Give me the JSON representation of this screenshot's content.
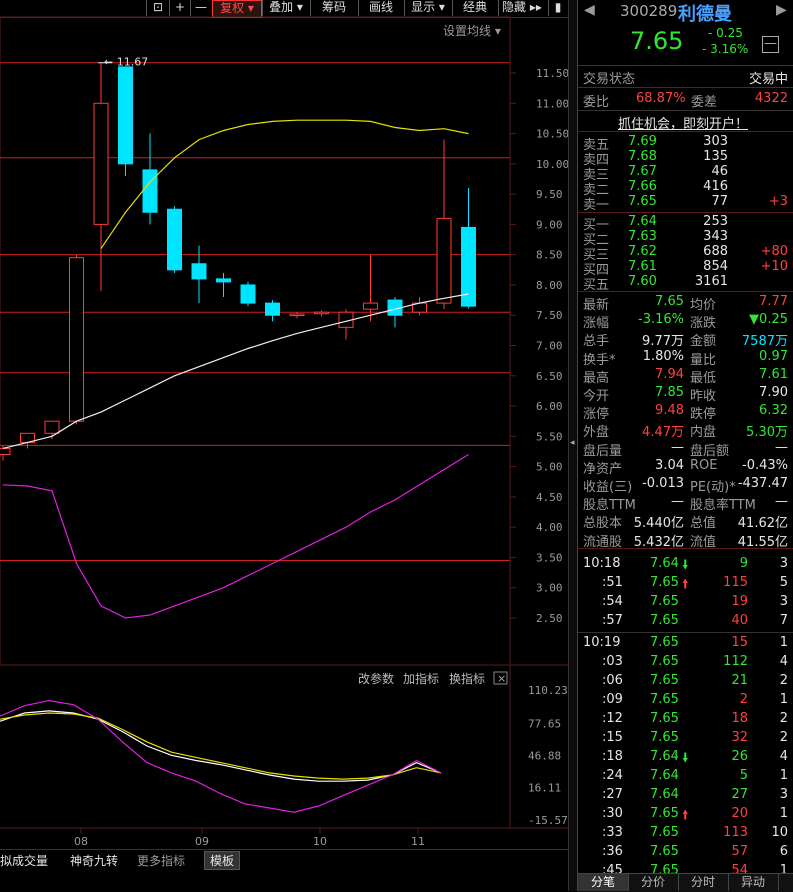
{
  "toolbar": {
    "buttons": [
      "+",
      "—",
      "复权",
      "叠加",
      "筹码",
      "画线",
      "显示",
      "经典",
      "隐藏"
    ],
    "active": "复权",
    "setting": "设置均线"
  },
  "chart_data": [
    {
      "type": "candlestick",
      "title": "",
      "ylim": [
        2.0,
        11.8
      ],
      "y_ticks": [
        "11.50",
        "11.00",
        "10.50",
        "10.00",
        "9.50",
        "9.00",
        "8.50",
        "8.00",
        "7.50",
        "7.00",
        "6.50",
        "6.00",
        "5.50",
        "5.00",
        "4.50",
        "4.00",
        "3.50",
        "3.00",
        "2.50"
      ],
      "x_ticks": [
        "08",
        "09",
        "10",
        "11"
      ],
      "max_label": "11.67",
      "candles": [
        {
          "o": 5.2,
          "h": 5.35,
          "l": 5.1,
          "c": 5.3
        },
        {
          "o": 5.4,
          "h": 5.55,
          "l": 5.3,
          "c": 5.55
        },
        {
          "o": 5.55,
          "h": 5.75,
          "l": 5.45,
          "c": 5.75
        },
        {
          "o": 5.75,
          "h": 8.5,
          "l": 5.7,
          "c": 8.45
        },
        {
          "o": 9.0,
          "h": 11.67,
          "l": 7.9,
          "c": 11.0
        },
        {
          "o": 11.6,
          "h": 11.6,
          "l": 9.8,
          "c": 10.0
        },
        {
          "o": 9.9,
          "h": 10.5,
          "l": 9.0,
          "c": 9.2
        },
        {
          "o": 9.25,
          "h": 9.3,
          "l": 8.2,
          "c": 8.25
        },
        {
          "o": 8.35,
          "h": 8.65,
          "l": 7.7,
          "c": 8.1
        },
        {
          "o": 8.1,
          "h": 8.2,
          "l": 7.8,
          "c": 8.05
        },
        {
          "o": 8.0,
          "h": 8.05,
          "l": 7.65,
          "c": 7.7
        },
        {
          "o": 7.7,
          "h": 7.75,
          "l": 7.4,
          "c": 7.5
        },
        {
          "o": 7.5,
          "h": 7.55,
          "l": 7.45,
          "c": 7.52
        },
        {
          "o": 7.53,
          "h": 7.58,
          "l": 7.48,
          "c": 7.55
        },
        {
          "o": 7.3,
          "h": 7.6,
          "l": 7.1,
          "c": 7.55
        },
        {
          "o": 7.6,
          "h": 8.5,
          "l": 7.4,
          "c": 7.7
        },
        {
          "o": 7.75,
          "h": 7.8,
          "l": 7.3,
          "c": 7.5
        },
        {
          "o": 7.55,
          "h": 7.8,
          "l": 7.5,
          "c": 7.7
        },
        {
          "o": 7.7,
          "h": 10.4,
          "l": 7.6,
          "c": 9.1
        },
        {
          "o": 8.95,
          "h": 9.6,
          "l": 7.61,
          "c": 7.65
        }
      ],
      "ma_yellow": [
        null,
        null,
        null,
        null,
        8.6,
        9.2,
        9.7,
        10.1,
        10.4,
        10.55,
        10.65,
        10.7,
        10.72,
        10.72,
        10.72,
        10.7,
        10.6,
        10.55,
        10.58,
        10.5
      ],
      "ma_white": [
        5.3,
        5.4,
        5.5,
        5.75,
        5.9,
        6.1,
        6.3,
        6.5,
        6.65,
        6.8,
        6.95,
        7.08,
        7.2,
        7.3,
        7.4,
        7.5,
        7.6,
        7.7,
        7.78,
        7.85
      ],
      "ma_magenta": [
        4.7,
        4.68,
        4.6,
        3.4,
        2.7,
        2.5,
        2.55,
        2.7,
        2.85,
        3.0,
        3.2,
        3.4,
        3.6,
        3.8,
        4.0,
        4.25,
        4.45,
        4.7,
        4.95,
        5.2
      ],
      "hlines": [
        11.67,
        10.1,
        8.5,
        7.55,
        6.55,
        5.35,
        3.45
      ]
    },
    {
      "type": "line",
      "title": "",
      "ylim": [
        -15.57,
        110.23
      ],
      "y_ticks": [
        "110.23",
        "77.65",
        "46.88",
        "16.11",
        "-15.57"
      ],
      "series": [
        {
          "values": [
            80,
            88,
            90,
            88,
            82,
            70,
            56,
            47,
            42,
            38,
            33,
            28,
            24,
            22,
            22,
            23,
            28,
            40,
            30
          ]
        },
        {
          "values": [
            82,
            86,
            88,
            87,
            83,
            72,
            60,
            50,
            45,
            40,
            35,
            30,
            27,
            25,
            24,
            25,
            28,
            35,
            30
          ]
        },
        {
          "values": [
            85,
            95,
            100,
            96,
            82,
            60,
            40,
            30,
            22,
            10,
            0,
            -4,
            -8,
            -2,
            8,
            18,
            28,
            42,
            30
          ]
        }
      ],
      "controls": [
        "改参数",
        "加指标",
        "换指标"
      ]
    }
  ],
  "bottom": {
    "items": [
      "拟成交量",
      "神奇九转",
      "更多指标",
      "模板"
    ]
  },
  "quote": {
    "code": "300289",
    "name": "利德曼",
    "price": "7.65",
    "change": "- 0.25",
    "pct": "- 3.16%",
    "status_label": "交易状态",
    "status_value": "交易中",
    "wb_label": "委比",
    "wb_value": "68.87%",
    "wc_label": "委差",
    "wc_value": "4322",
    "ad": "抓住机会，即刻开户！",
    "asks": [
      {
        "label": "卖五",
        "price": "7.69",
        "vol": "303",
        "chg": ""
      },
      {
        "label": "卖四",
        "price": "7.68",
        "vol": "135",
        "chg": ""
      },
      {
        "label": "卖三",
        "price": "7.67",
        "vol": "46",
        "chg": ""
      },
      {
        "label": "卖二",
        "price": "7.66",
        "vol": "416",
        "chg": ""
      },
      {
        "label": "卖一",
        "price": "7.65",
        "vol": "77",
        "chg": "+3"
      }
    ],
    "bids": [
      {
        "label": "买一",
        "price": "7.64",
        "vol": "253",
        "chg": ""
      },
      {
        "label": "买二",
        "price": "7.63",
        "vol": "343",
        "chg": ""
      },
      {
        "label": "买三",
        "price": "7.62",
        "vol": "688",
        "chg": "+80"
      },
      {
        "label": "买四",
        "price": "7.61",
        "vol": "854",
        "chg": "+10"
      },
      {
        "label": "买五",
        "price": "7.60",
        "vol": "3161",
        "chg": ""
      }
    ],
    "stats": [
      {
        "l1": "最新",
        "v1": "7.65",
        "c1": "green",
        "l2": "均价",
        "v2": "7.77",
        "c2": "red"
      },
      {
        "l1": "涨幅",
        "v1": "-3.16%",
        "c1": "green",
        "l2": "涨跌",
        "v2": "▼0.25",
        "c2": "green"
      },
      {
        "l1": "总手",
        "v1": "9.77万",
        "c1": "white",
        "l2": "金额",
        "v2": "7587万",
        "c2": "cyan"
      },
      {
        "l1": "换手*",
        "v1": "1.80%",
        "c1": "white",
        "l2": "量比",
        "v2": "0.97",
        "c2": "green"
      },
      {
        "l1": "最高",
        "v1": "7.94",
        "c1": "red",
        "l2": "最低",
        "v2": "7.61",
        "c2": "green"
      },
      {
        "l1": "今开",
        "v1": "7.85",
        "c1": "green",
        "l2": "昨收",
        "v2": "7.90",
        "c2": "white"
      },
      {
        "l1": "涨停",
        "v1": "9.48",
        "c1": "red",
        "l2": "跌停",
        "v2": "6.32",
        "c2": "green"
      },
      {
        "l1": "外盘",
        "v1": "4.47万",
        "c1": "red",
        "l2": "内盘",
        "v2": "5.30万",
        "c2": "green"
      },
      {
        "l1": "盘后量",
        "v1": "—",
        "c1": "white",
        "l2": "盘后额",
        "v2": "—",
        "c2": "white"
      },
      {
        "l1": "净资产",
        "v1": "3.04",
        "c1": "white",
        "l2": "ROE",
        "v2": "-0.43%",
        "c2": "white"
      },
      {
        "l1": "收益(三)",
        "v1": "-0.013",
        "c1": "white",
        "l2": "PE(动)*",
        "v2": "-437.47",
        "c2": "white"
      },
      {
        "l1": "股息TTM",
        "v1": "—",
        "c1": "white",
        "l2": "股息率TTM",
        "v2": "—",
        "c2": "white"
      },
      {
        "l1": "总股本",
        "v1": "5.440亿",
        "c1": "white",
        "l2": "总值",
        "v2": "41.62亿",
        "c2": "white"
      },
      {
        "l1": "流通股",
        "v1": "5.432亿",
        "c1": "white",
        "l2": "流值",
        "v2": "41.55亿",
        "c2": "white"
      }
    ],
    "ticks": [
      {
        "t": "10:18",
        "p": "7.64",
        "arrow": "dn",
        "v": "9",
        "vc": "green",
        "n": "3"
      },
      {
        "t": ":51",
        "p": "7.65",
        "arrow": "up",
        "v": "115",
        "vc": "red",
        "n": "5"
      },
      {
        "t": ":54",
        "p": "7.65",
        "arrow": "",
        "v": "19",
        "vc": "red",
        "n": "3"
      },
      {
        "t": ":57",
        "p": "7.65",
        "arrow": "",
        "v": "40",
        "vc": "red",
        "n": "7"
      },
      {
        "t": "10:19",
        "p": "7.65",
        "arrow": "",
        "v": "15",
        "vc": "red",
        "n": "1"
      },
      {
        "t": ":03",
        "p": "7.65",
        "arrow": "",
        "v": "112",
        "vc": "green",
        "n": "4"
      },
      {
        "t": ":06",
        "p": "7.65",
        "arrow": "",
        "v": "21",
        "vc": "green",
        "n": "2"
      },
      {
        "t": ":09",
        "p": "7.65",
        "arrow": "",
        "v": "2",
        "vc": "red",
        "n": "1"
      },
      {
        "t": ":12",
        "p": "7.65",
        "arrow": "",
        "v": "18",
        "vc": "red",
        "n": "2"
      },
      {
        "t": ":15",
        "p": "7.65",
        "arrow": "",
        "v": "32",
        "vc": "red",
        "n": "2"
      },
      {
        "t": ":18",
        "p": "7.64",
        "arrow": "dn",
        "v": "26",
        "vc": "green",
        "n": "4"
      },
      {
        "t": ":24",
        "p": "7.64",
        "arrow": "",
        "v": "5",
        "vc": "green",
        "n": "1"
      },
      {
        "t": ":27",
        "p": "7.64",
        "arrow": "",
        "v": "27",
        "vc": "green",
        "n": "3"
      },
      {
        "t": ":30",
        "p": "7.65",
        "arrow": "up",
        "v": "20",
        "vc": "red",
        "n": "1"
      },
      {
        "t": ":33",
        "p": "7.65",
        "arrow": "",
        "v": "113",
        "vc": "red",
        "n": "10"
      },
      {
        "t": ":36",
        "p": "7.65",
        "arrow": "",
        "v": "57",
        "vc": "red",
        "n": "6"
      },
      {
        "t": ":45",
        "p": "7.65",
        "arrow": "",
        "v": "54",
        "vc": "red",
        "n": "1"
      }
    ],
    "tabs": [
      "分笔",
      "分价",
      "分时",
      "异动"
    ]
  }
}
